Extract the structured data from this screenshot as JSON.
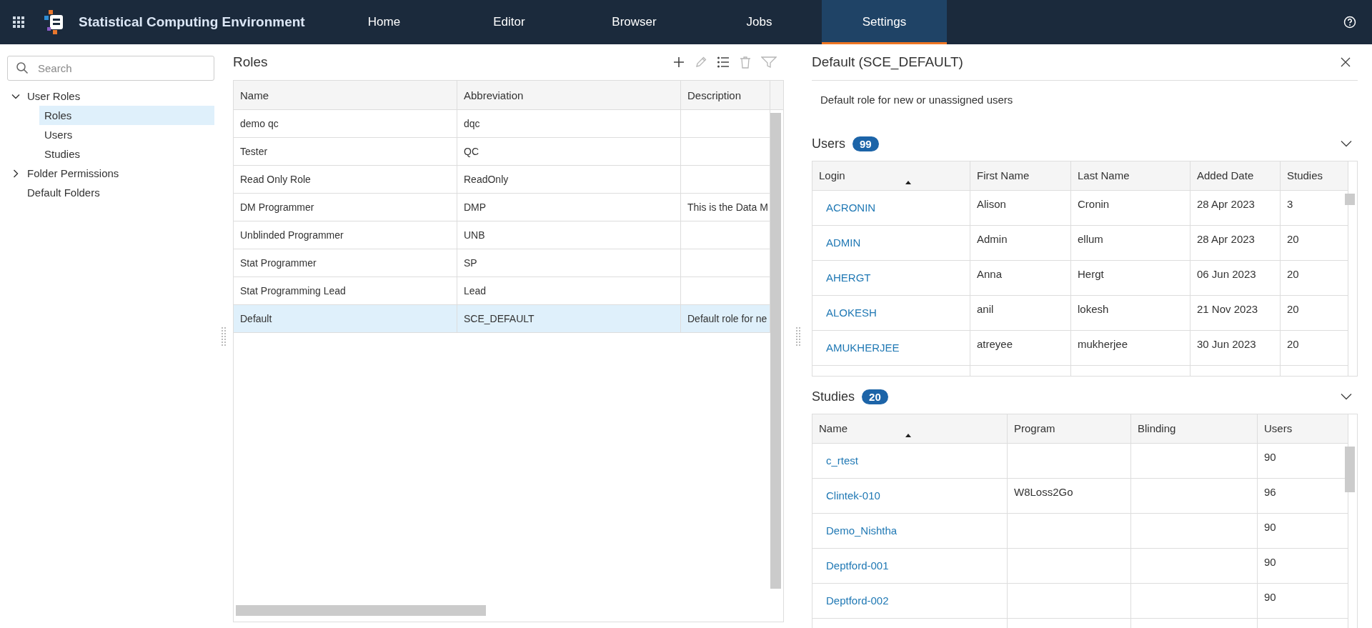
{
  "app": {
    "title": "Statistical Computing Environment"
  },
  "nav": [
    {
      "label": "Home",
      "selected": false
    },
    {
      "label": "Editor",
      "selected": false
    },
    {
      "label": "Browser",
      "selected": false
    },
    {
      "label": "Jobs",
      "selected": false
    },
    {
      "label": "Settings",
      "selected": true
    }
  ],
  "sidebar": {
    "search": {
      "placeholder": "Search"
    },
    "tree": [
      {
        "label": "User Roles",
        "expanded": true,
        "selected": false,
        "children": [
          {
            "label": "Roles",
            "selected": true
          },
          {
            "label": "Users",
            "selected": false
          },
          {
            "label": "Studies",
            "selected": false
          }
        ]
      },
      {
        "label": "Folder Permissions",
        "expanded": false,
        "selected": false
      },
      {
        "label": "Default Folders",
        "selected": false
      }
    ]
  },
  "roles": {
    "title": "Roles",
    "toolbar": [
      {
        "kind": "add",
        "disabled": false
      },
      {
        "kind": "edit",
        "disabled": true
      },
      {
        "kind": "list",
        "disabled": false
      },
      {
        "kind": "delete",
        "disabled": true
      },
      {
        "kind": "filter",
        "disabled": true
      }
    ],
    "columns": [
      "Name",
      "Abbreviation",
      "Description"
    ],
    "rows": [
      {
        "cells": [
          "demo qc",
          "dqc",
          ""
        ],
        "selected": false
      },
      {
        "cells": [
          "Tester",
          "QC",
          ""
        ],
        "selected": false
      },
      {
        "cells": [
          "Read Only Role",
          "ReadOnly",
          ""
        ],
        "selected": false
      },
      {
        "cells": [
          "DM Programmer",
          "DMP",
          "This is the Data M"
        ],
        "selected": false
      },
      {
        "cells": [
          "Unblinded Programmer",
          "UNB",
          ""
        ],
        "selected": false
      },
      {
        "cells": [
          "Stat Programmer",
          "SP",
          ""
        ],
        "selected": false
      },
      {
        "cells": [
          "Stat Programming Lead",
          "Lead",
          ""
        ],
        "selected": false
      },
      {
        "cells": [
          "Default",
          "SCE_DEFAULT",
          "Default role for ne"
        ],
        "selected": true
      }
    ]
  },
  "detail": {
    "title": "Default (SCE_DEFAULT)",
    "description": "Default role for new or unassigned users",
    "users": {
      "title": "Users",
      "count": "99",
      "expanded": true,
      "columns": [
        {
          "label": "Login",
          "sorted": true
        },
        {
          "label": "First Name",
          "sorted": false
        },
        {
          "label": "Last Name",
          "sorted": false
        },
        {
          "label": "Added Date",
          "sorted": false
        },
        {
          "label": "Studies",
          "sorted": false
        }
      ],
      "rows": [
        [
          "ACRONIN",
          "Alison",
          "Cronin",
          "28 Apr 2023",
          "3"
        ],
        [
          "ADMIN",
          "Admin",
          "ellum",
          "28 Apr 2023",
          "20"
        ],
        [
          "AHERGT",
          "Anna",
          "Hergt",
          "06 Jun 2023",
          "20"
        ],
        [
          "ALOKESH",
          "anil",
          "lokesh",
          "21 Nov 2023",
          "20"
        ],
        [
          "AMUKHERJEE",
          "atreyee",
          "mukherjee",
          "30 Jun 2023",
          "20"
        ]
      ]
    },
    "studies": {
      "title": "Studies",
      "count": "20",
      "expanded": true,
      "columns": [
        {
          "label": "Name",
          "sorted": true
        },
        {
          "label": "Program",
          "sorted": false
        },
        {
          "label": "Blinding",
          "sorted": false
        },
        {
          "label": "Users",
          "sorted": false
        }
      ],
      "rows": [
        [
          "c_rtest",
          "",
          "",
          "90"
        ],
        [
          "Clintek-010",
          "W8Loss2Go",
          "",
          "96"
        ],
        [
          "Demo_Nishtha",
          "",
          "",
          "90"
        ],
        [
          "Deptford-001",
          "",
          "",
          "90"
        ],
        [
          "Deptford-002",
          "",
          "",
          "90"
        ]
      ]
    }
  }
}
